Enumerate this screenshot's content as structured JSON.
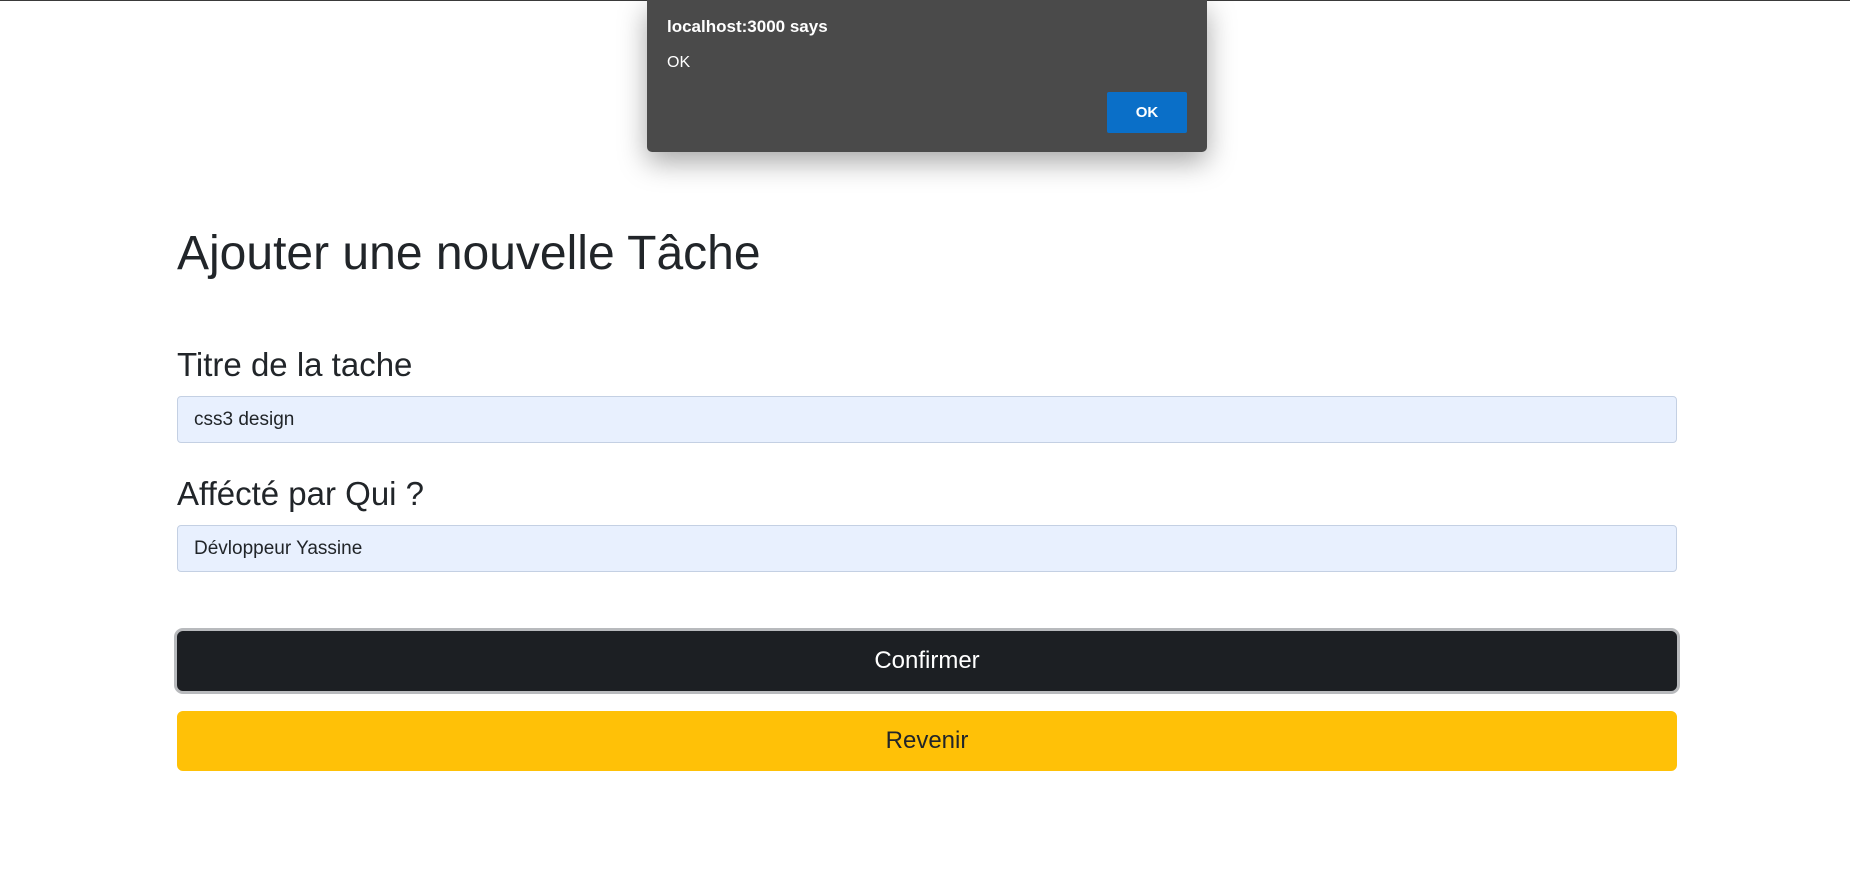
{
  "alert": {
    "origin": "localhost:3000 says",
    "message": "OK",
    "ok_label": "OK"
  },
  "form": {
    "title": "Ajouter une nouvelle Tâche",
    "titre_label": "Titre de la tache",
    "titre_value": "css3 design",
    "affecte_label": "Affécté par Qui ?",
    "affecte_value": "Dévloppeur Yassine",
    "confirm_label": "Confirmer",
    "back_label": "Revenir"
  },
  "colors": {
    "confirm_bg": "#1c1f23",
    "back_bg": "#ffc107",
    "input_bg": "#e8f0fe",
    "alert_bg": "#4a4a4a",
    "alert_ok_bg": "#0a6fc8"
  }
}
